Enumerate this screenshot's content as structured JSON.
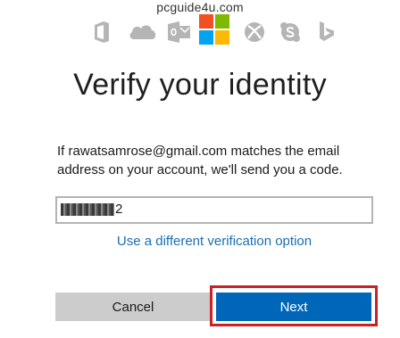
{
  "watermark": "pcguide4u.com",
  "icons": {
    "row": [
      "office-icon",
      "onedrive-icon",
      "outlook-icon",
      "microsoft-logo",
      "xbox-icon",
      "skype-icon",
      "bing-icon"
    ],
    "icon_color": "#b5b5b5",
    "logo_colors": [
      "#f25022",
      "#7fba00",
      "#00a4ef",
      "#ffb900"
    ]
  },
  "heading": "Verify your identity",
  "description": "If rawatsamrose@gmail.com matches the email address on your account, we'll send you a code.",
  "code_field": {
    "visible_suffix": "2"
  },
  "alt_option_link": "Use a different verification option",
  "buttons": {
    "cancel": "Cancel",
    "next": "Next"
  },
  "colors": {
    "accent": "#0067b8",
    "link": "#1a6fb0",
    "highlight_border": "#cc1f26",
    "cancel_bg": "#cccccc"
  }
}
